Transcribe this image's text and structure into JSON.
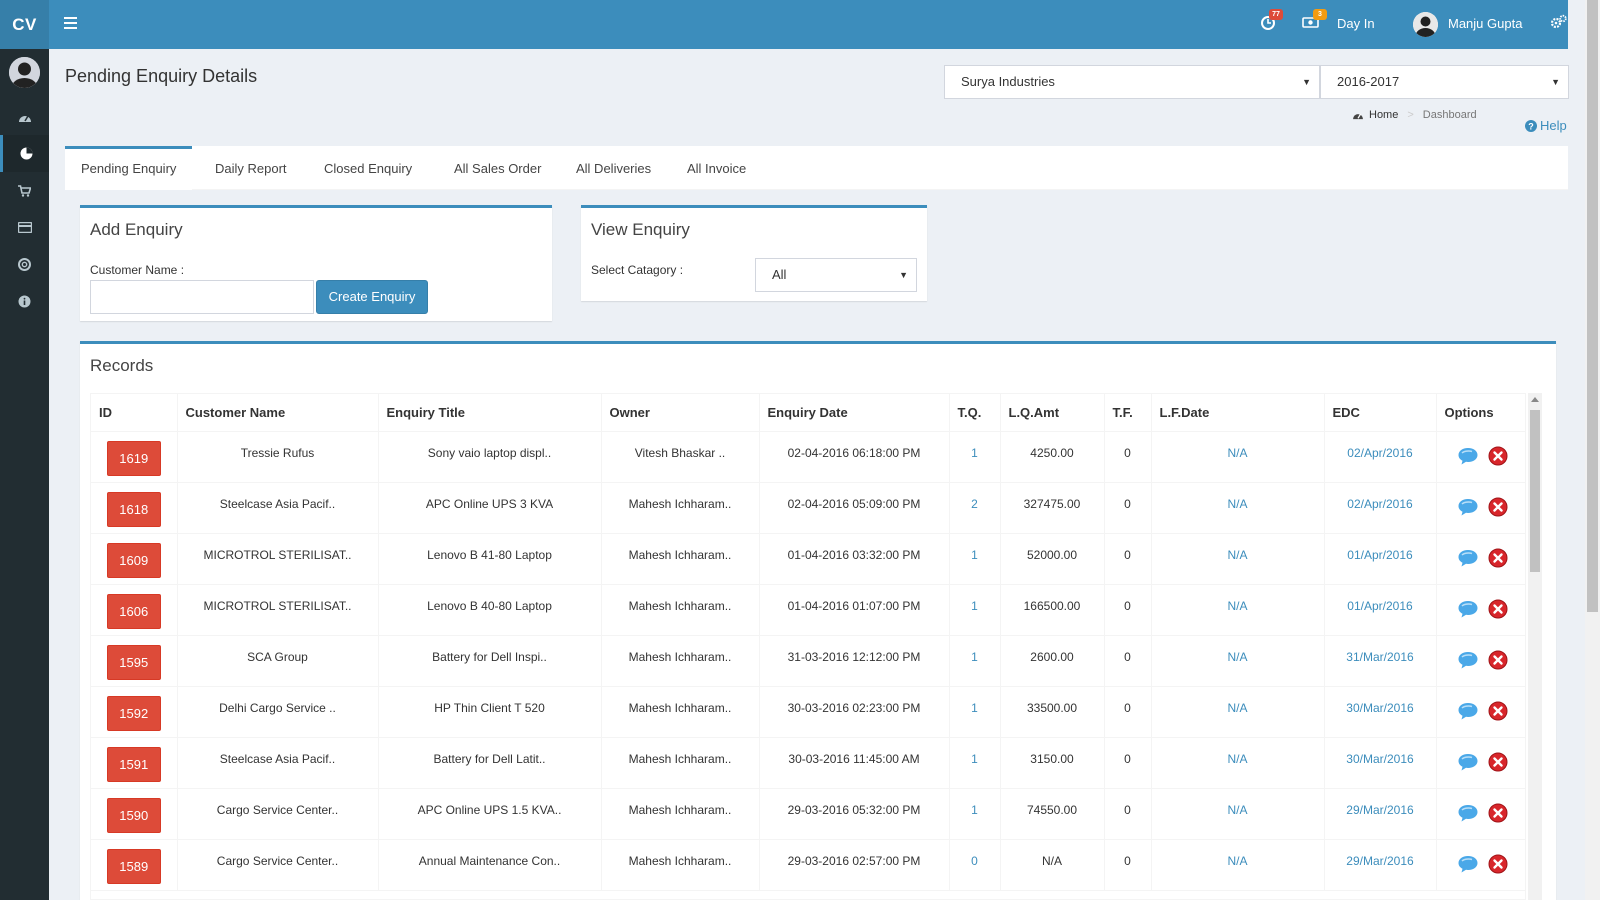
{
  "app": {
    "logo": "CV",
    "notifications": {
      "count1": "77",
      "count2": "3"
    },
    "day_in_label": "Day In",
    "user_name": "Manju Gupta"
  },
  "header": {
    "title": "Pending Enquiry Details",
    "company_select": "Surya Industries",
    "year_select": "2016-2017",
    "breadcrumb": {
      "home": "Home",
      "current": "Dashboard"
    },
    "help_label": "Help"
  },
  "tabs": [
    {
      "label": "Pending Enquiry"
    },
    {
      "label": "Daily Report"
    },
    {
      "label": "Closed Enquiry"
    },
    {
      "label": "All Sales Order"
    },
    {
      "label": "All Deliveries"
    },
    {
      "label": "All Invoice"
    }
  ],
  "add_enquiry": {
    "title": "Add Enquiry",
    "customer_label": "Customer Name :",
    "customer_value": "",
    "create_button": "Create Enquiry"
  },
  "view_enquiry": {
    "title": "View Enquiry",
    "category_label": "Select Catagory :",
    "category_value": "All"
  },
  "records": {
    "title": "Records",
    "columns": [
      "ID",
      "Customer Name",
      "Enquiry Title",
      "Owner",
      "Enquiry Date",
      "T.Q.",
      "L.Q.Amt",
      "T.F.",
      "L.F.Date",
      "EDC",
      "Options"
    ],
    "rows": [
      {
        "id": "1619",
        "customer": "Tressie Rufus",
        "title": "Sony vaio laptop displ..",
        "owner": "Vitesh Bhaskar ..",
        "date": "02-04-2016 06:18:00 PM",
        "tq": "1",
        "lqamt": "4250.00",
        "tf": "0",
        "lfdate": "N/A",
        "edc": "02/Apr/2016"
      },
      {
        "id": "1618",
        "customer": "Steelcase Asia Pacif..",
        "title": "APC Online UPS 3 KVA",
        "owner": "Mahesh Ichharam..",
        "date": "02-04-2016 05:09:00 PM",
        "tq": "2",
        "lqamt": "327475.00",
        "tf": "0",
        "lfdate": "N/A",
        "edc": "02/Apr/2016"
      },
      {
        "id": "1609",
        "customer": "MICROTROL STERILISAT..",
        "title": "Lenovo B 41-80 Laptop",
        "owner": "Mahesh Ichharam..",
        "date": "01-04-2016 03:32:00 PM",
        "tq": "1",
        "lqamt": "52000.00",
        "tf": "0",
        "lfdate": "N/A",
        "edc": "01/Apr/2016"
      },
      {
        "id": "1606",
        "customer": "MICROTROL STERILISAT..",
        "title": "Lenovo B 40-80 Laptop",
        "owner": "Mahesh Ichharam..",
        "date": "01-04-2016 01:07:00 PM",
        "tq": "1",
        "lqamt": "166500.00",
        "tf": "0",
        "lfdate": "N/A",
        "edc": "01/Apr/2016"
      },
      {
        "id": "1595",
        "customer": "SCA Group",
        "title": "Battery for Dell Inspi..",
        "owner": "Mahesh Ichharam..",
        "date": "31-03-2016 12:12:00 PM",
        "tq": "1",
        "lqamt": "2600.00",
        "tf": "0",
        "lfdate": "N/A",
        "edc": "31/Mar/2016"
      },
      {
        "id": "1592",
        "customer": "Delhi Cargo Service ..",
        "title": "HP Thin Client T 520",
        "owner": "Mahesh Ichharam..",
        "date": "30-03-2016 02:23:00 PM",
        "tq": "1",
        "lqamt": "33500.00",
        "tf": "0",
        "lfdate": "N/A",
        "edc": "30/Mar/2016"
      },
      {
        "id": "1591",
        "customer": "Steelcase Asia Pacif..",
        "title": "Battery for Dell Latit..",
        "owner": "Mahesh Ichharam..",
        "date": "30-03-2016 11:45:00 AM",
        "tq": "1",
        "lqamt": "3150.00",
        "tf": "0",
        "lfdate": "N/A",
        "edc": "30/Mar/2016"
      },
      {
        "id": "1590",
        "customer": "Cargo Service Center..",
        "title": "APC Online UPS 1.5 KVA..",
        "owner": "Mahesh Ichharam..",
        "date": "29-03-2016 05:32:00 PM",
        "tq": "1",
        "lqamt": "74550.00",
        "tf": "0",
        "lfdate": "N/A",
        "edc": "29/Mar/2016"
      },
      {
        "id": "1589",
        "customer": "Cargo Service Center..",
        "title": "Annual Maintenance Con..",
        "owner": "Mahesh Ichharam..",
        "date": "29-03-2016 02:57:00 PM",
        "tq": "0",
        "lqamt": "N/A",
        "tf": "0",
        "lfdate": "N/A",
        "edc": "29/Mar/2016"
      }
    ]
  },
  "colors": {
    "primary": "#3c8dbc",
    "danger": "#dd4b39",
    "sidebar": "#222d32"
  }
}
